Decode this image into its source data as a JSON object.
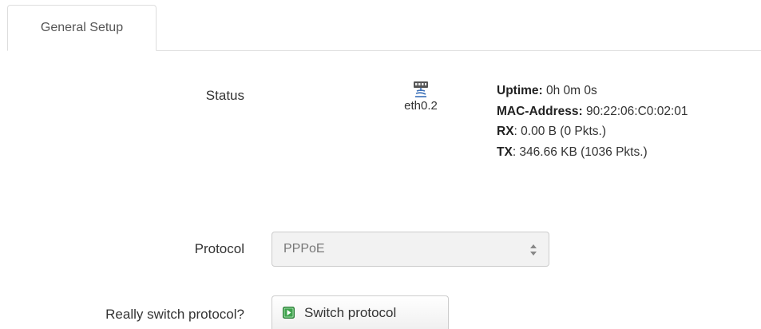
{
  "tabs": [
    {
      "label": "General Setup",
      "active": true
    }
  ],
  "status": {
    "label": "Status",
    "device": {
      "icon": "ethernet-port-icon",
      "name": "eth0.2"
    },
    "info": [
      {
        "key": "Uptime:",
        "value": " 0h 0m 0s"
      },
      {
        "key": "MAC-Address:",
        "value": " 90:22:06:C0:02:01"
      },
      {
        "key": "RX",
        "value": ": 0.00 B (0 Pkts.)"
      },
      {
        "key": "TX",
        "value": ": 346.66 KB (1036 Pkts.)"
      }
    ]
  },
  "protocol": {
    "label": "Protocol",
    "selected": "PPPoE"
  },
  "switch_protocol": {
    "label": "Really switch protocol?",
    "button_label": "Switch protocol",
    "button_icon": "go-arrow-icon"
  },
  "colors": {
    "button_icon_green": "#3fa34d",
    "border": "#cccccc"
  }
}
